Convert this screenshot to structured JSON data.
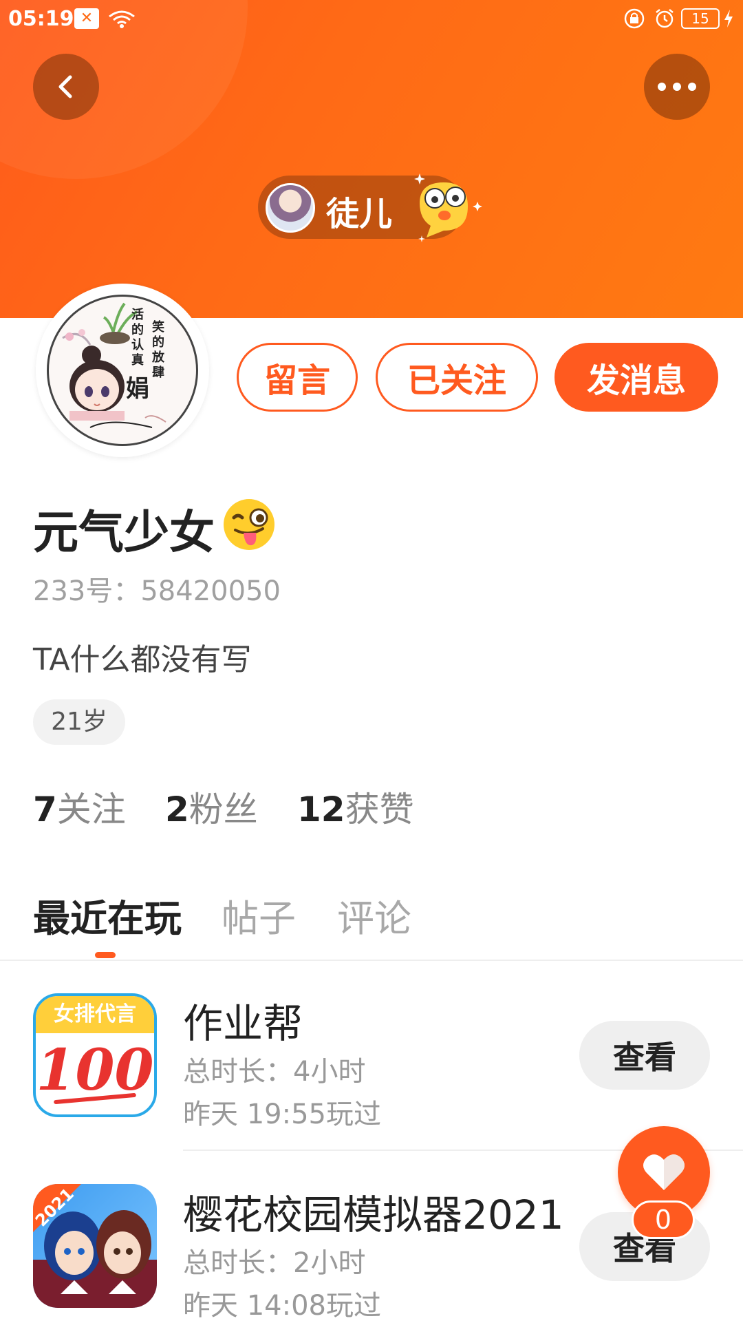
{
  "status_bar": {
    "time": "05:19",
    "battery": "15",
    "icons": [
      "notification-x-icon",
      "wifi-icon",
      "lock-rotation-icon",
      "alarm-icon",
      "battery-icon",
      "charging-icon"
    ]
  },
  "header": {
    "title": "徒儿",
    "back_icon": "chevron-left-icon",
    "more_icon": "more-dots-icon",
    "gradient_colors": [
      "#ff5b1b",
      "#ff7a12"
    ]
  },
  "actions": {
    "comment_label": "留言",
    "followed_label": "已关注",
    "message_label": "发消息",
    "accent_color": "#ff5a1f"
  },
  "profile": {
    "nickname": "元气少女",
    "uid": "233号：58420050",
    "bio": "TA什么都没有写",
    "age": "21岁",
    "avatar_text": [
      "活的认真",
      "笑的放肆",
      "娟"
    ]
  },
  "stats": {
    "following_count": "7",
    "following_label": "关注",
    "fans_count": "2",
    "fans_label": "粉丝",
    "likes_count": "12",
    "likes_label": "获赞"
  },
  "tabs": {
    "recent": "最近在玩",
    "posts": "帖子",
    "comments": "评论"
  },
  "games": [
    {
      "name": "作业帮",
      "duration": "总时长：4小时",
      "last_played": "昨天 19:55玩过",
      "view_label": "查看",
      "icon_banner": "女排代言",
      "icon_number": "100"
    },
    {
      "name": "樱花校园模拟器2021",
      "duration": "总时长：2小时",
      "last_played": "昨天 14:08玩过",
      "view_label": "查看",
      "icon_badge": "2021"
    }
  ],
  "like_fab": {
    "count": "0",
    "icon": "heart-icon"
  }
}
